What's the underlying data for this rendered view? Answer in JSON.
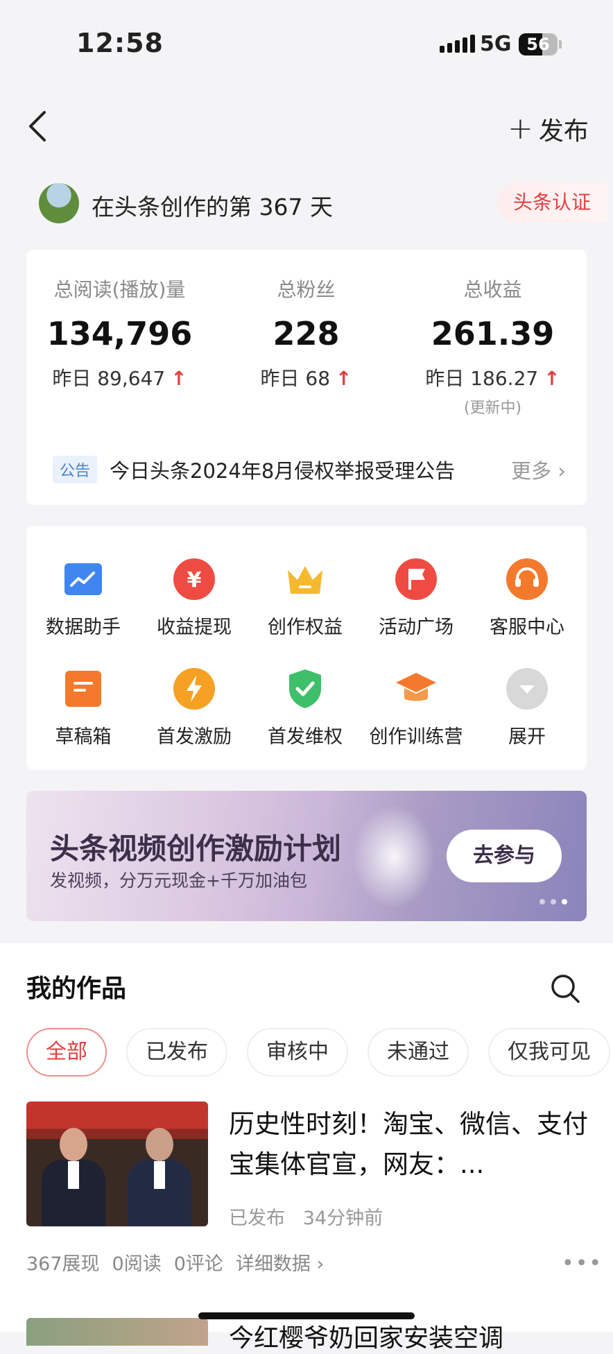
{
  "status_bar": {
    "time": "12:58",
    "network": "5G",
    "battery": "56"
  },
  "nav": {
    "publish_label": "发布"
  },
  "creator": {
    "days_text": "在头条创作的第 367 天",
    "badge": "头条认证"
  },
  "stats": [
    {
      "label": "总阅读(播放)量",
      "value": "134,796",
      "yesterday": "昨日 89,647",
      "note": ""
    },
    {
      "label": "总粉丝",
      "value": "228",
      "yesterday": "昨日 68",
      "note": ""
    },
    {
      "label": "总收益",
      "value": "261.39",
      "yesterday": "昨日 186.27",
      "note": "(更新中)"
    }
  ],
  "notice": {
    "tag": "公告",
    "text": "今日头条2024年8月侵权举报受理公告",
    "more": "更多"
  },
  "tools": [
    {
      "label": "数据助手",
      "icon": "chart-icon"
    },
    {
      "label": "收益提现",
      "icon": "yuan-icon"
    },
    {
      "label": "创作权益",
      "icon": "crown-icon"
    },
    {
      "label": "活动广场",
      "icon": "flag-icon"
    },
    {
      "label": "客服中心",
      "icon": "headset-icon"
    },
    {
      "label": "草稿箱",
      "icon": "draft-icon"
    },
    {
      "label": "首发激励",
      "icon": "lightning-icon"
    },
    {
      "label": "首发维权",
      "icon": "shield-check-icon"
    },
    {
      "label": "创作训练营",
      "icon": "graduation-cap-icon"
    },
    {
      "label": "展开",
      "icon": "expand-icon"
    }
  ],
  "banner": {
    "title": "头条视频创作激励计划",
    "subtitle": "发视频，分万元现金+千万加油包",
    "cta": "去参与"
  },
  "works": {
    "title": "我的作品",
    "tabs": [
      "全部",
      "已发布",
      "审核中",
      "未通过",
      "仅我可见"
    ],
    "article": {
      "title": "历史性时刻！淘宝、微信、支付宝集体官宣，网友：...",
      "status": "已发布",
      "time": "34分钟前",
      "impressions": "367展现",
      "reads": "0阅读",
      "comments": "0评论",
      "detail": "详细数据"
    },
    "next_title": "今红樱爷奶回家安装空调"
  },
  "colors": {
    "accent": "#e0403f",
    "background": "#f4f4f6"
  }
}
